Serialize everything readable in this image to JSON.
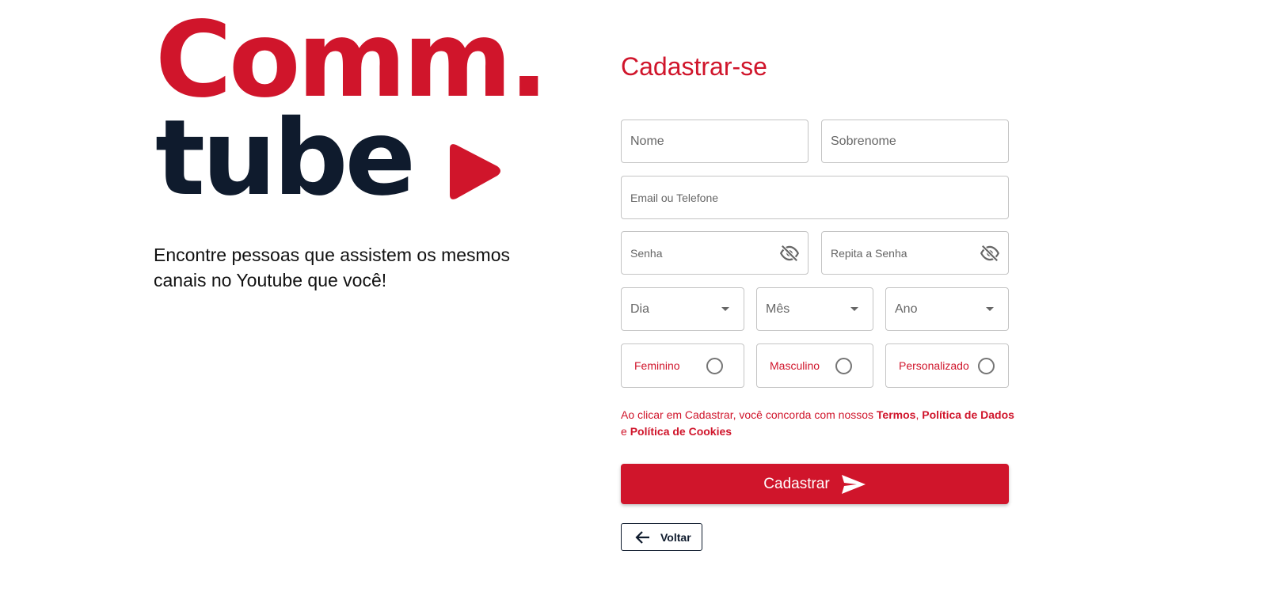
{
  "logo": {
    "line1": "Comm.",
    "line2": "tube",
    "icon": "play-icon",
    "colors": {
      "red": "#d0152b",
      "navy": "#0f1b2d"
    }
  },
  "tagline": "Encontre pessoas que assistem os mesmos canais no Youtube que você!",
  "form": {
    "title": "Cadastrar-se",
    "first_name_placeholder": "Nome",
    "last_name_placeholder": "Sobrenome",
    "contact_placeholder": "Email ou Telefone",
    "password_placeholder": "Senha",
    "password_repeat_placeholder": "Repita a Senha",
    "password_icon": "eye-off-icon",
    "birth": {
      "day_label": "Dia",
      "month_label": "Mês",
      "year_label": "Ano"
    },
    "gender": {
      "female": "Feminino",
      "male": "Masculino",
      "custom": "Personalizado"
    },
    "terms": {
      "prefix": "Ao clicar em Cadastrar, você concorda com nossos ",
      "terms_link": "Termos",
      "sep1": ", ",
      "data_policy_link": "Política de Dados",
      "sep2": " e ",
      "cookies_link": "Política de Cookies"
    },
    "submit_label": "Cadastrar",
    "submit_icon": "send-icon",
    "back_label": "Voltar",
    "back_icon": "arrow-left-icon"
  },
  "colors": {
    "accent": "#d0152b",
    "dark": "#0f1b2d",
    "border": "#c4c4c4"
  }
}
